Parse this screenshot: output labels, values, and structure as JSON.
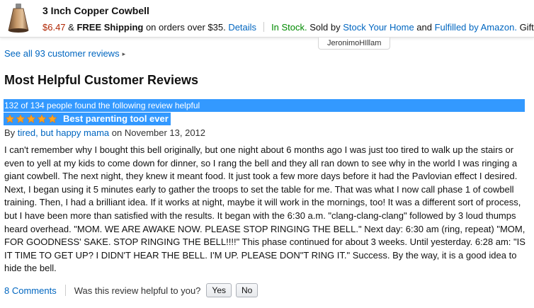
{
  "product": {
    "title": "3 Inch Copper Cowbell",
    "price": "$6.47",
    "shipping_prefix": " & ",
    "free_shipping": "FREE Shipping",
    "shipping_rest": " on orders over $35. ",
    "details_link": "Details",
    "in_stock": "In Stock.",
    "sold_by_prefix": " Sold by ",
    "seller": "Stock Your Home",
    "and_text": " and ",
    "fulfilled": "Fulfilled by Amazon.",
    "gift": " Gift"
  },
  "username_tag": "JeronimoHIllam",
  "see_all": "See all 93 customer reviews",
  "section_title": "Most Helpful Customer Reviews",
  "review": {
    "helpful_count": "132 of 134 people found the following review helpful",
    "rating": 5,
    "title": "Best parenting tool ever",
    "by": "By ",
    "author": "tired, but happy mama",
    "date": " on November 13, 2012",
    "body": "I can't remember why I bought this bell originally, but one night about 6 months ago I was just too tired to walk up the stairs or even to yell at my kids to come down for dinner, so I rang the bell and they all ran down to see why in the world I was ringing a giant cowbell. The next night, they knew it meant food. It just took a few more days before it had the Pavlovian effect I desired. Next, I began using it 5 minutes early to gather the troops to set the table for me. That was what I now call phase 1 of cowbell training. Then, I had a brilliant idea. If it works at night, maybe it will work in the mornings, too! It was a different sort of process, but I have been more than satisfied with the results. It began with the 6:30 a.m. \"clang-clang-clang\" followed by 3 loud thumps heard overhead. \"MOM. WE ARE AWAKE NOW. PLEASE STOP RINGING THE BELL.\" Next day: 6:30 am (ring, repeat) \"MOM, FOR GOODNESS' SAKE. STOP RINGING THE BELL!!!!\" This phase continued for about 3 weeks. Until yesterday. 6:28 am: \"IS IT TIME TO GET UP? I DIDN'T HEAR THE BELL. I'M UP. PLEASE DON\"T RING IT.\" Success. By the way, it is a good idea to hide the bell.",
    "comments": "8 Comments",
    "question": "Was this review helpful to you?",
    "yes": "Yes",
    "no": "No"
  },
  "colors": {
    "link": "#0066c0",
    "price": "#b12704",
    "in_stock": "#008a00",
    "highlight": "#3399ff",
    "star": "#ffa41c"
  },
  "icons": {
    "product": "cowbell-product-image",
    "caret": "right-caret-icon",
    "star": "star-icon"
  }
}
